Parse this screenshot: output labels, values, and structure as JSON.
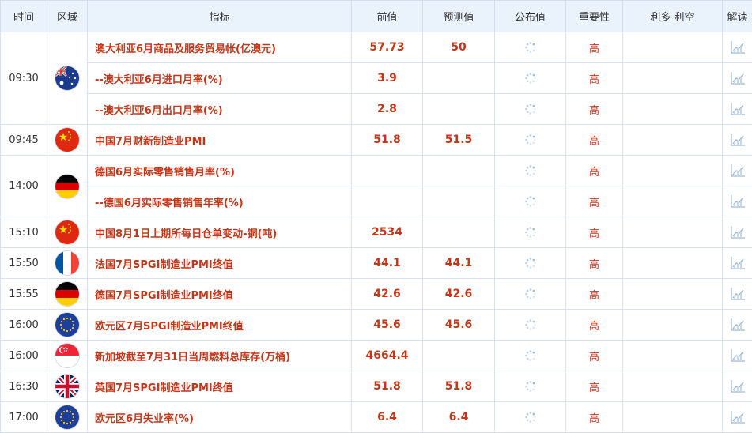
{
  "header": {
    "time": "时间",
    "region": "区域",
    "indicator": "指标",
    "previous": "前值",
    "forecast": "预测值",
    "published": "公布值",
    "importance": "重要性",
    "impact": "利多 利空",
    "interpret": "解读"
  },
  "rows": [
    {
      "time": "09:30",
      "flag": "australia",
      "indicator": "澳大利亚6月商品及服务贸易帐(亿澳元)",
      "previous": "57.73",
      "forecast": "50",
      "importance": "高"
    },
    {
      "indicator": "--澳大利亚6月进口月率(%)",
      "previous": "3.9",
      "forecast": "",
      "importance": "高"
    },
    {
      "indicator": "--澳大利亚6月出口月率(%)",
      "previous": "2.8",
      "forecast": "",
      "importance": "高"
    },
    {
      "time": "09:45",
      "flag": "china",
      "indicator": "中国7月财新制造业PMI",
      "previous": "51.8",
      "forecast": "51.5",
      "importance": "高"
    },
    {
      "time": "14:00",
      "flag": "germany",
      "indicator": "德国6月实际零售销售月率(%)",
      "previous": "",
      "forecast": "",
      "importance": "高"
    },
    {
      "indicator": "--德国6月实际零售销售年率(%)",
      "previous": "",
      "forecast": "",
      "importance": "高"
    },
    {
      "time": "15:10",
      "flag": "china",
      "indicator": "中国8月1日上期所每日仓单变动-铜(吨)",
      "previous": "2534",
      "forecast": "",
      "importance": "高"
    },
    {
      "time": "15:50",
      "flag": "france",
      "indicator": "法国7月SPGI制造业PMI终值",
      "previous": "44.1",
      "forecast": "44.1",
      "importance": "高"
    },
    {
      "time": "15:55",
      "flag": "germany",
      "indicator": "德国7月SPGI制造业PMI终值",
      "previous": "42.6",
      "forecast": "42.6",
      "importance": "高"
    },
    {
      "time": "16:00",
      "flag": "eu",
      "indicator": "欧元区7月SPGI制造业PMI终值",
      "previous": "45.6",
      "forecast": "45.6",
      "importance": "高"
    },
    {
      "time": "16:00",
      "flag": "singapore",
      "indicator": "新加坡截至7月31日当周燃料总库存(万桶)",
      "previous": "4664.4",
      "forecast": "",
      "importance": "高"
    },
    {
      "time": "16:30",
      "flag": "uk",
      "indicator": "英国7月SPGI制造业PMI终值",
      "previous": "51.8",
      "forecast": "51.8",
      "importance": "高"
    },
    {
      "time": "17:00",
      "flag": "eu",
      "indicator": "欧元区6月失业率(%)",
      "previous": "6.4",
      "forecast": "6.4",
      "importance": "高"
    }
  ],
  "icons": {
    "published": "loading-spinner-icon",
    "interpret": "line-chart-icon"
  },
  "colors": {
    "accent": "#c4361a",
    "header_bg": "#eaf2fb",
    "border": "#d6e2ef"
  }
}
